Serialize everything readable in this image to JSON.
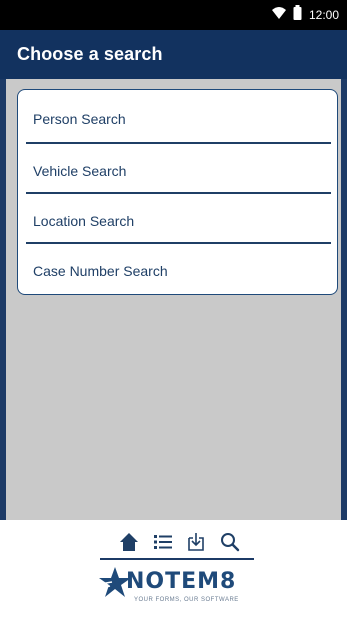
{
  "status_bar": {
    "time": "12:00",
    "icons": [
      "wifi-icon",
      "battery-icon"
    ]
  },
  "header": {
    "title": "Choose a search"
  },
  "search_options": [
    {
      "label": "Person Search"
    },
    {
      "label": "Vehicle Search"
    },
    {
      "label": "Location Search"
    },
    {
      "label": "Case Number Search"
    }
  ],
  "bottom_nav": {
    "items": [
      "home-icon",
      "list-icon",
      "download-icon",
      "search-icon"
    ]
  },
  "brand": {
    "name": "NOTEM8",
    "tagline": "YOUR FORMS, OUR SOFTWARE"
  },
  "colors": {
    "primary": "#12325f",
    "accent": "#1f4a7a",
    "background": "#c9c9c9"
  }
}
